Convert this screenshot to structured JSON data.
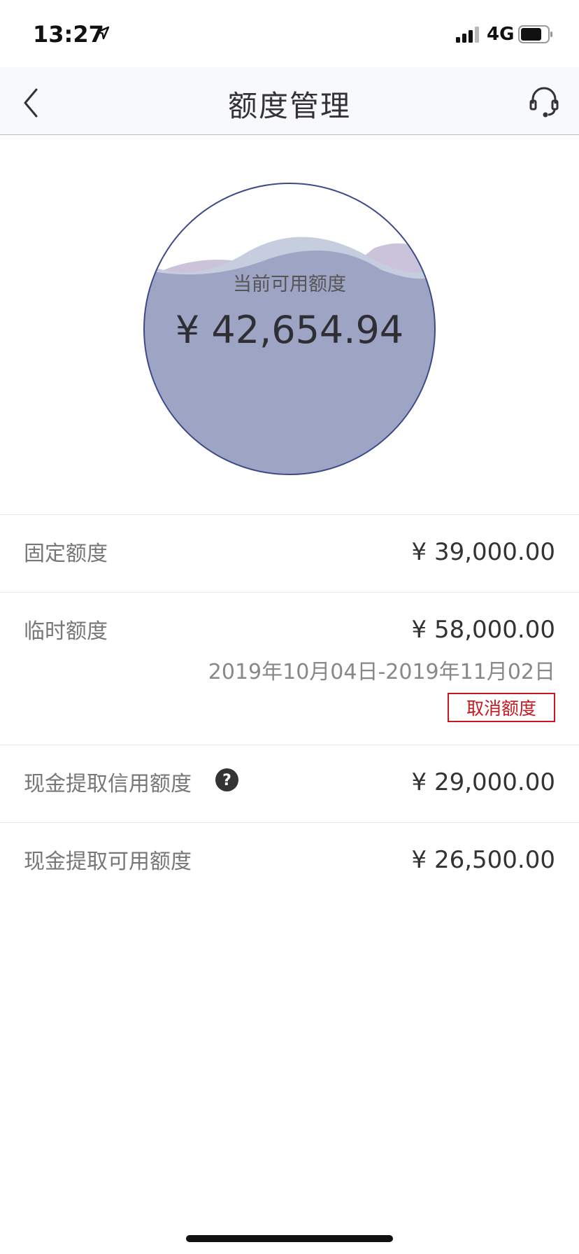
{
  "status_bar": {
    "time": "13:27",
    "network": "4G",
    "icons": [
      "location-arrow-icon",
      "signal-bars-icon",
      "battery-icon"
    ]
  },
  "nav": {
    "title": "额度管理",
    "icons": [
      "back-chevron-icon",
      "headset-support-icon"
    ]
  },
  "gauge": {
    "label": "当前可用额度",
    "value": "¥ 42,654.94",
    "colors": {
      "outline": "#3d4a8a",
      "fill": "#9ea5c4",
      "wave_a": "#c5cddf",
      "wave_b": "#cbc3d9"
    }
  },
  "rows": [
    {
      "label": "固定额度",
      "value": "¥ 39,000.00"
    },
    {
      "label": "临时额度",
      "value": "¥ 58,000.00",
      "date_range": "2019年10月04日-2019年11月02日",
      "action_label": "取消额度",
      "action_color": "#c8191e"
    },
    {
      "label": "现金提取信用额度",
      "value": "¥ 29,000.00",
      "icon": "help-question-icon"
    },
    {
      "label": "现金提取可用额度",
      "value": "¥ 26,500.00"
    }
  ]
}
